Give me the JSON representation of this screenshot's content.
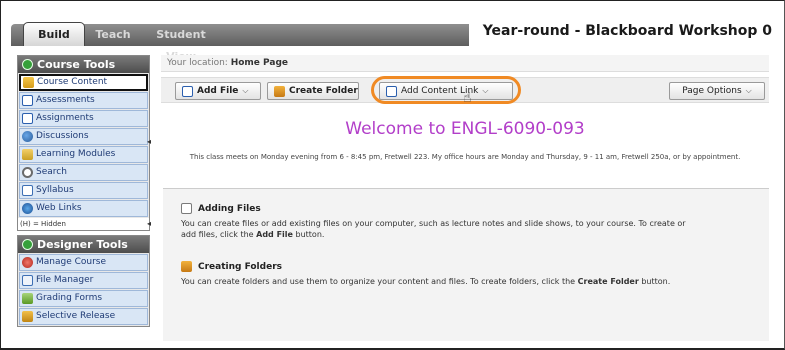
{
  "tabs": [
    {
      "label": "Build"
    },
    {
      "label": "Teach"
    },
    {
      "label": "Student View"
    }
  ],
  "course_title": "Year-round - Blackboard Workshop 0",
  "course_tools": {
    "title": "Course Tools",
    "items": [
      {
        "label": "Course Content",
        "icon": "folder-icon",
        "active": true
      },
      {
        "label": "Assessments",
        "icon": "assessment-icon"
      },
      {
        "label": "Assignments",
        "icon": "assignment-icon"
      },
      {
        "label": "Discussions",
        "icon": "discussion-icon"
      },
      {
        "label": "Learning Modules",
        "icon": "module-icon"
      },
      {
        "label": "Search",
        "icon": "search-icon"
      },
      {
        "label": "Syllabus",
        "icon": "syllabus-icon"
      },
      {
        "label": "Web Links",
        "icon": "web-links-icon"
      }
    ],
    "hidden_note": "(H) = Hidden"
  },
  "designer_tools": {
    "title": "Designer Tools",
    "items": [
      {
        "label": "Manage Course",
        "icon": "manage-icon"
      },
      {
        "label": "File Manager",
        "icon": "file-manager-icon"
      },
      {
        "label": "Grading Forms",
        "icon": "grading-icon"
      },
      {
        "label": "Selective Release",
        "icon": "release-icon"
      }
    ]
  },
  "location": {
    "prefix": "Your location:",
    "current": "Home Page"
  },
  "toolbar": {
    "add_file": "Add File",
    "create_folder": "Create Folder",
    "add_content_link": "Add Content Link",
    "page_options": "Page Options",
    "caret": "⌵"
  },
  "welcome": "Welcome to ENGL-6090-093",
  "intro": "This class meets on Monday evening from 6 - 8:45 pm, Fretwell 223. My office hours are Monday and Thursday, 9 - 11 am, Fretwell 250a, or by appointment.",
  "sections": [
    {
      "title": "Adding Files",
      "body_pre": "You can create files or add existing files on your computer, such as lecture notes and slide shows, to your course. To create or add files, click the ",
      "body_bold": "Add File",
      "body_post": " button."
    },
    {
      "title": "Creating Folders",
      "body_pre": "You can create folders and use them to organize your content and files. To create folders, click the ",
      "body_bold": "Create Folder",
      "body_post": " button."
    }
  ]
}
